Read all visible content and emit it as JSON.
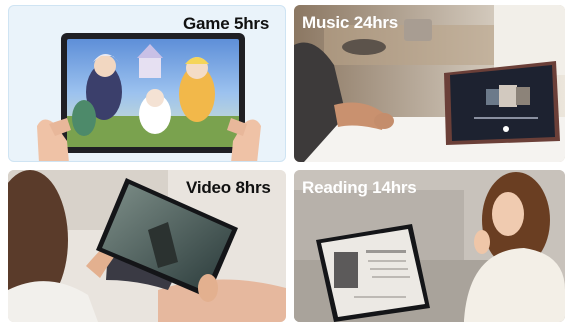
{
  "tiles": [
    {
      "caption": "Game 5hrs",
      "caption_color": "#111111",
      "scene": "hands-holding-tablet-playing-anime-game"
    },
    {
      "caption": "Music 24hrs",
      "caption_color": "#ffffff",
      "scene": "kitchen-tablet-on-counter-music-player"
    },
    {
      "caption": "Video 8hrs",
      "caption_color": "#111111",
      "scene": "person-on-couch-watching-video"
    },
    {
      "caption": "Reading 14hrs",
      "caption_color": "#ffffff",
      "scene": "woman-reading-on-tablet-sofa"
    }
  ],
  "colors": {
    "game_bg": "#eaf3fa",
    "tile_border": "#cfe4f3"
  }
}
